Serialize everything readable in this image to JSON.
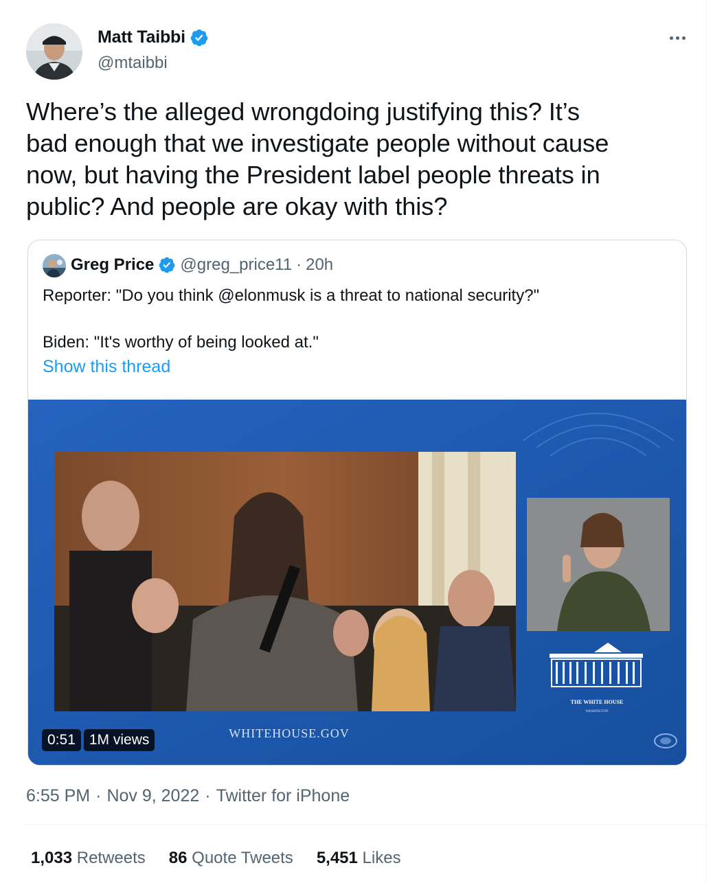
{
  "author": {
    "name": "Matt Taibbi",
    "handle": "@mtaibbi"
  },
  "tweet": {
    "text": "Where’s the alleged wrongdoing justifying this? It’s\nbad enough that we investigate people without cause\nnow, but having the President label people threats in\npublic? And people are okay with this?"
  },
  "quote": {
    "name": "Greg Price",
    "handle": "@greg_price11",
    "separator": "·",
    "age": "20h",
    "text": "Reporter: \"Do you think @elonmusk is a threat to national security?\"\n\nBiden: \"It's worthy of being looked at.\"",
    "show_thread": "Show this thread",
    "video": {
      "duration": "0:51",
      "views": "1M views",
      "watermark": "WHITEHOUSE.GOV",
      "logo_text": "THE WHITE HOUSE",
      "logo_subtext": "WASHINGTON"
    }
  },
  "meta": {
    "time": "6:55 PM",
    "sep1": "·",
    "date": "Nov 9, 2022",
    "sep2": "·",
    "source": "Twitter for iPhone"
  },
  "stats": {
    "retweets_count": "1,033",
    "retweets_label": "Retweets",
    "quotes_count": "86",
    "quotes_label": "Quote Tweets",
    "likes_count": "5,451",
    "likes_label": "Likes"
  },
  "colors": {
    "accent": "#1d9bf0",
    "secondary_text": "#536471",
    "video_background": "#1d5fbd"
  }
}
